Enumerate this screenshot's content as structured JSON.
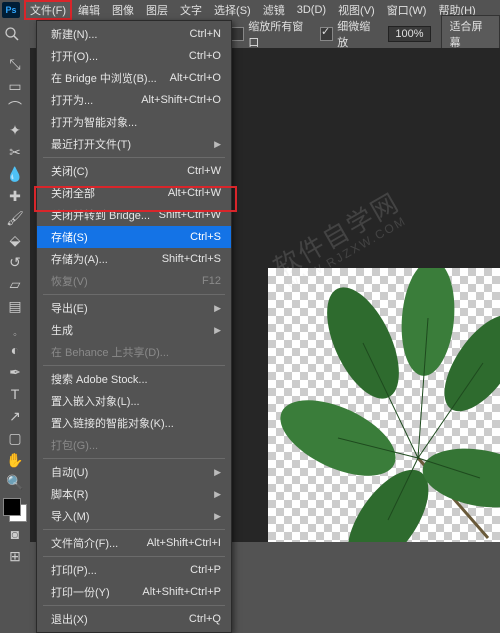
{
  "app": {
    "logo": "Ps"
  },
  "menubar": {
    "items": [
      {
        "label": "文件(F)",
        "active": true
      },
      {
        "label": "编辑",
        "active": false
      },
      {
        "label": "图像",
        "active": false
      },
      {
        "label": "图层",
        "active": false
      },
      {
        "label": "文字",
        "active": false
      },
      {
        "label": "选择(S)",
        "active": false
      },
      {
        "label": "滤镜",
        "active": false
      },
      {
        "label": "3D(D)",
        "active": false
      },
      {
        "label": "视图(V)",
        "active": false
      },
      {
        "label": "窗口(W)",
        "active": false
      },
      {
        "label": "帮助(H)",
        "active": false
      }
    ]
  },
  "options": {
    "zoom_all_windows": "缩放所有窗口",
    "scrubby_zoom": "细微缩放",
    "zoom_value": "100%",
    "fit_screen": "适合屏幕"
  },
  "dropdown": {
    "groups": [
      [
        {
          "label": "新建(N)...",
          "shortcut": "Ctrl+N"
        },
        {
          "label": "打开(O)...",
          "shortcut": "Ctrl+O"
        },
        {
          "label": "在 Bridge 中浏览(B)...",
          "shortcut": "Alt+Ctrl+O"
        },
        {
          "label": "打开为...",
          "shortcut": "Alt+Shift+Ctrl+O"
        },
        {
          "label": "打开为智能对象...",
          "shortcut": ""
        },
        {
          "label": "最近打开文件(T)",
          "shortcut": "",
          "submenu": true
        }
      ],
      [
        {
          "label": "关闭(C)",
          "shortcut": "Ctrl+W"
        },
        {
          "label": "关闭全部",
          "shortcut": "Alt+Ctrl+W"
        },
        {
          "label": "关闭并转到 Bridge...",
          "shortcut": "Shift+Ctrl+W"
        },
        {
          "label": "存储(S)",
          "shortcut": "Ctrl+S",
          "highlight": true
        },
        {
          "label": "存储为(A)...",
          "shortcut": "Shift+Ctrl+S"
        },
        {
          "label": "恢复(V)",
          "shortcut": "F12",
          "disabled": true
        }
      ],
      [
        {
          "label": "导出(E)",
          "shortcut": "",
          "submenu": true
        },
        {
          "label": "生成",
          "shortcut": "",
          "submenu": true
        },
        {
          "label": "在 Behance 上共享(D)...",
          "shortcut": "",
          "disabled": true
        }
      ],
      [
        {
          "label": "搜索 Adobe Stock...",
          "shortcut": ""
        },
        {
          "label": "置入嵌入对象(L)...",
          "shortcut": ""
        },
        {
          "label": "置入链接的智能对象(K)...",
          "shortcut": ""
        },
        {
          "label": "打包(G)...",
          "shortcut": "",
          "disabled": true
        }
      ],
      [
        {
          "label": "自动(U)",
          "shortcut": "",
          "submenu": true
        },
        {
          "label": "脚本(R)",
          "shortcut": "",
          "submenu": true
        },
        {
          "label": "导入(M)",
          "shortcut": "",
          "submenu": true
        }
      ],
      [
        {
          "label": "文件简介(F)...",
          "shortcut": "Alt+Shift+Ctrl+I"
        }
      ],
      [
        {
          "label": "打印(P)...",
          "shortcut": "Ctrl+P"
        },
        {
          "label": "打印一份(Y)",
          "shortcut": "Alt+Shift+Ctrl+P"
        }
      ],
      [
        {
          "label": "退出(X)",
          "shortcut": "Ctrl+Q"
        }
      ]
    ]
  },
  "watermark": {
    "main": "软件自学网",
    "sub": "WWW.RJZXW.COM"
  },
  "tools": [
    "move",
    "marquee",
    "lasso",
    "wand",
    "crop",
    "eyedropper",
    "healing",
    "brush",
    "stamp",
    "history",
    "eraser",
    "gradient",
    "blur",
    "dodge",
    "pen",
    "type",
    "path",
    "rectangle",
    "hand",
    "zoom"
  ]
}
